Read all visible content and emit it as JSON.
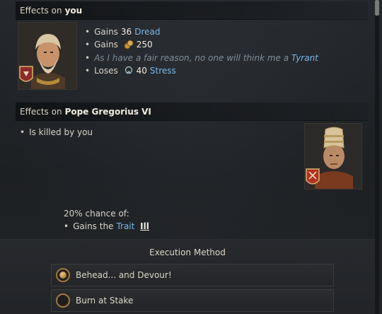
{
  "you_section": {
    "header_prefix": "Effects on",
    "header_name": "you",
    "effects": [
      {
        "prefix": "Gains",
        "value": "36",
        "link": "Dread"
      },
      {
        "prefix": "Gains",
        "icon": "gold-coin-icon",
        "value": "250"
      },
      {
        "italic_text": "As I have a fair reason, no one will think me a",
        "link": "Tyrant"
      },
      {
        "prefix": "Loses",
        "icon": "stress-icon",
        "value": "40",
        "link": "Stress"
      }
    ]
  },
  "target_section": {
    "header_prefix": "Effects on",
    "header_name": "Pope Gregorius VI",
    "effects": [
      {
        "text": "Is killed by you"
      }
    ]
  },
  "chance": {
    "text": "20% chance of:",
    "effect_prefix": "Gains the",
    "effect_link": "Trait",
    "trait_glyph": "Ill"
  },
  "execution": {
    "title": "Execution Method",
    "options": [
      {
        "label": "Behead... and Devour!",
        "selected": true
      },
      {
        "label": "Burn at Stake",
        "selected": false
      }
    ]
  },
  "colors": {
    "link": "#79b7e8",
    "gold_accent": "#b07c33",
    "background": "#1f2225"
  }
}
